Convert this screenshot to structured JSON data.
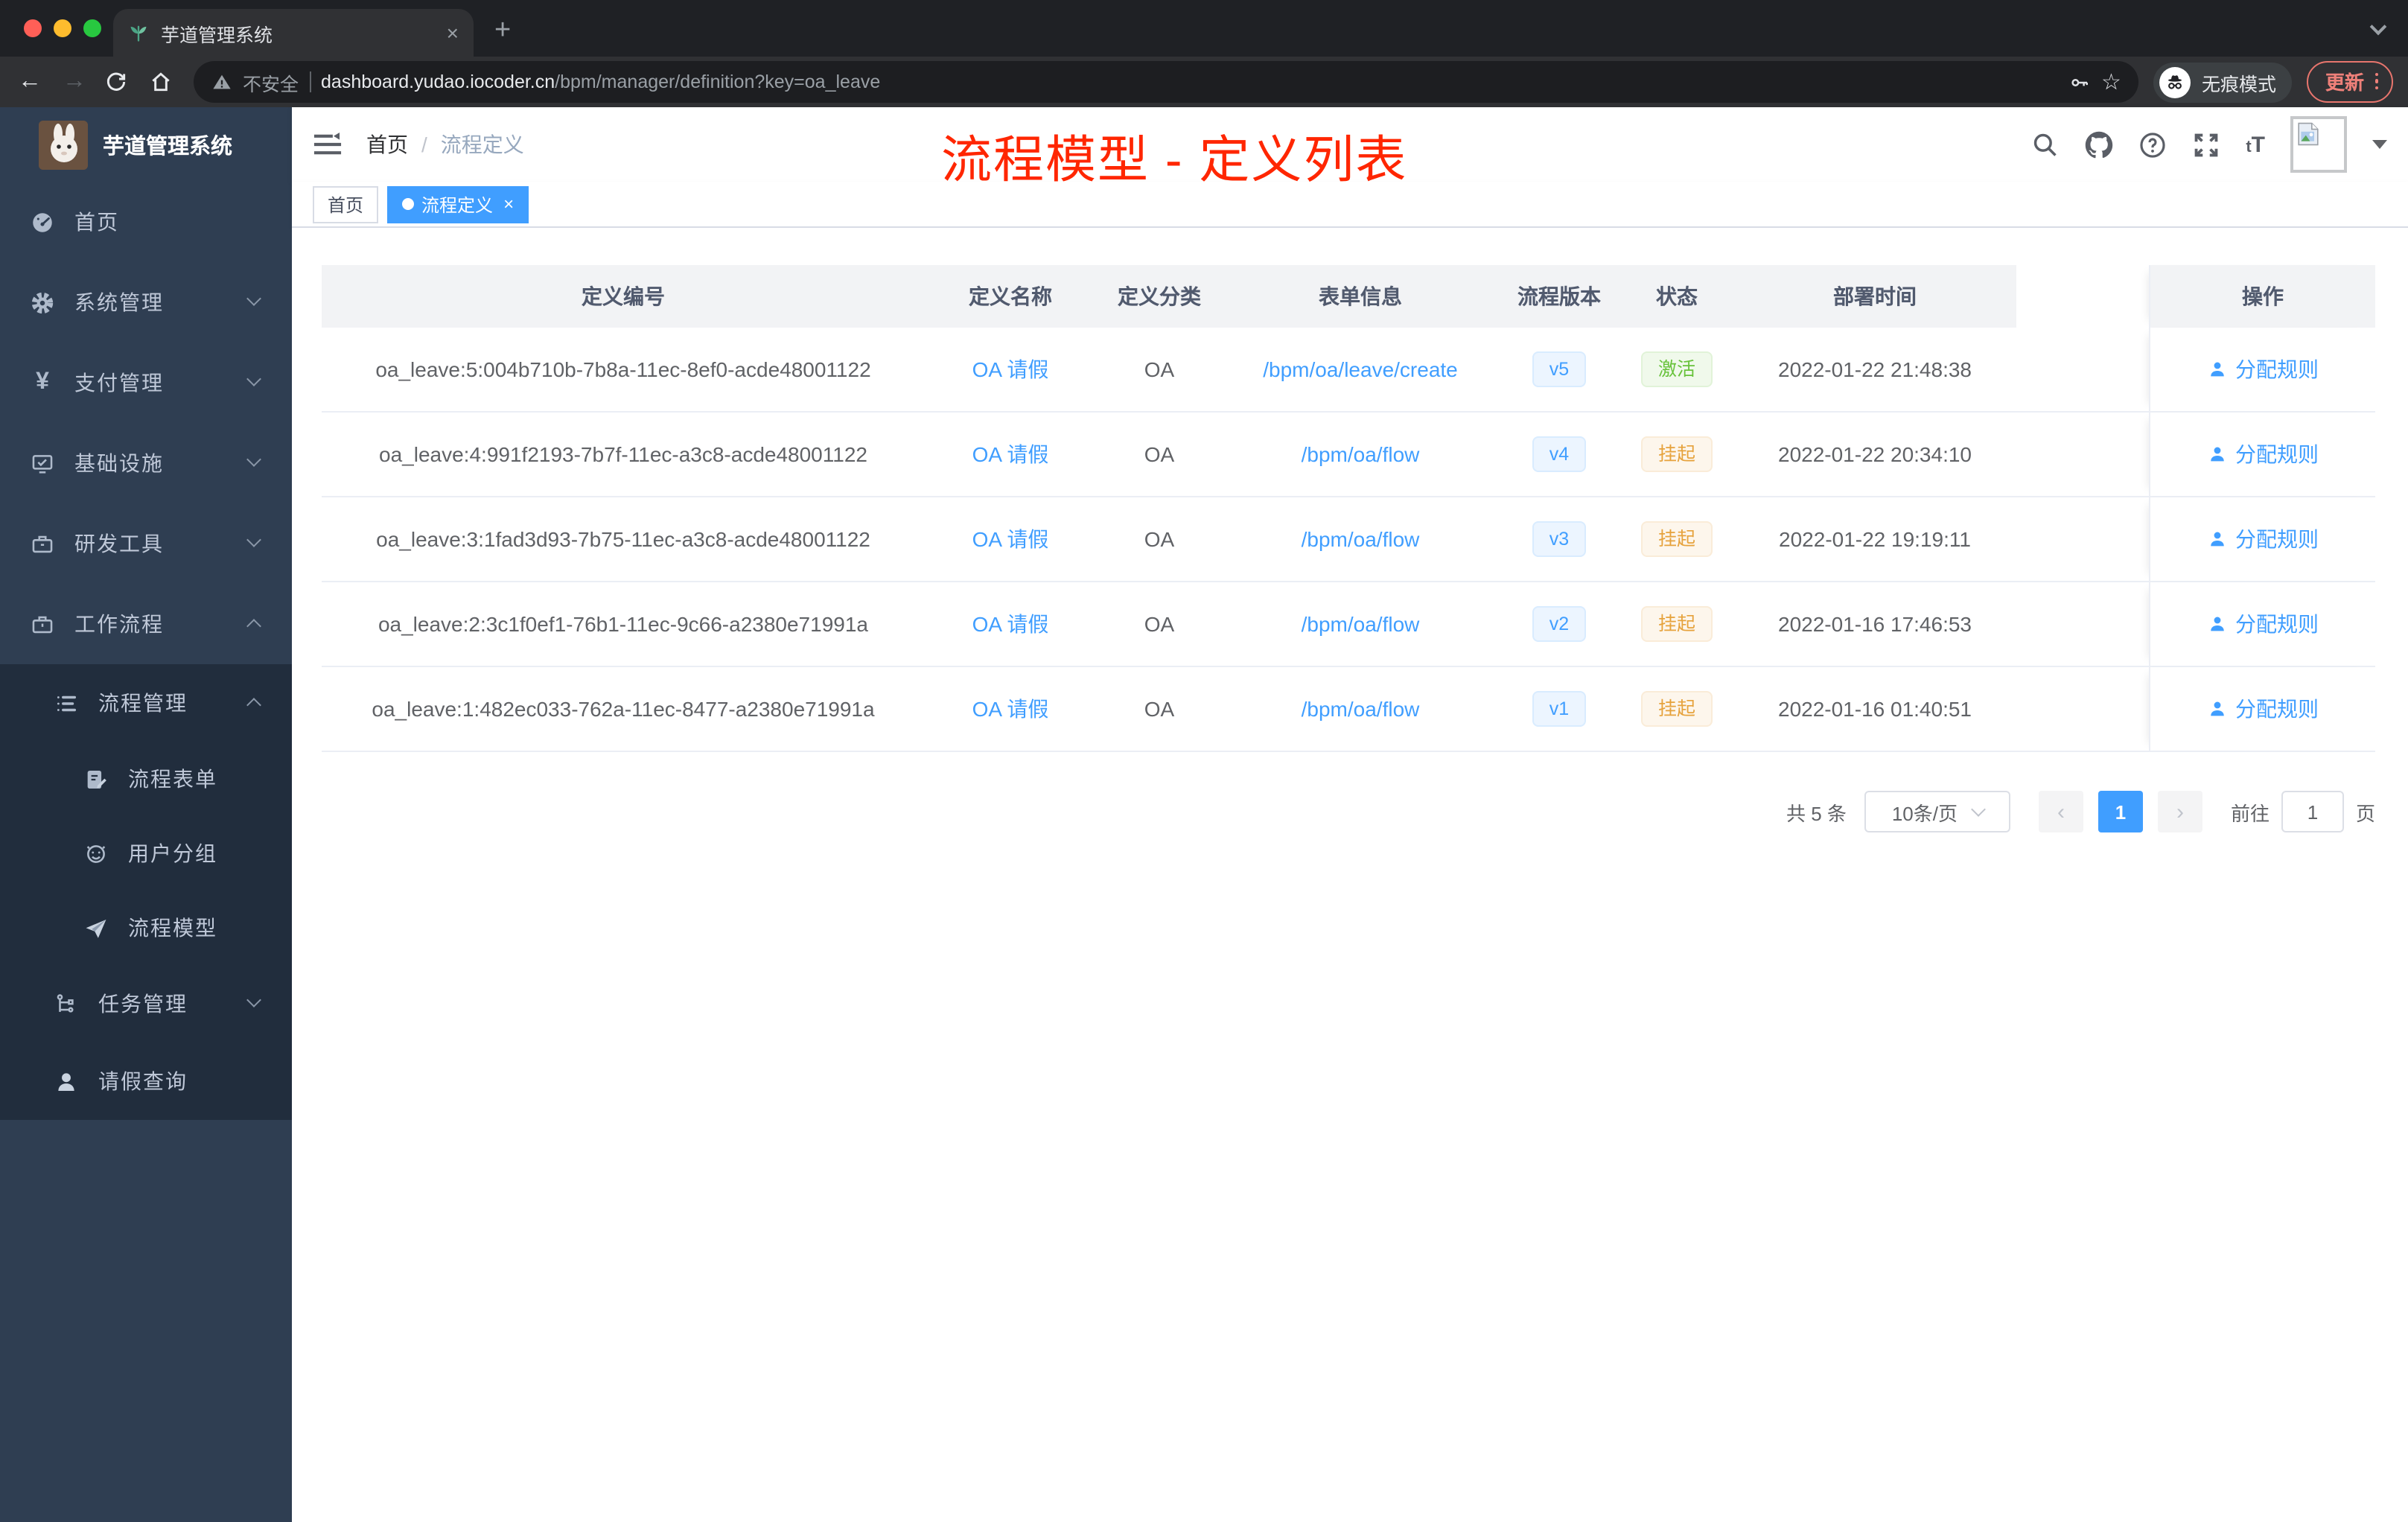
{
  "browser": {
    "tab_title": "芋道管理系统",
    "new_tab_label": "+",
    "tab_close": "×",
    "back": "←",
    "forward": "→",
    "security_label": "不安全",
    "url_domain": "dashboard.yudao.iocoder.cn",
    "url_path": "/bpm/manager/definition?key=oa_leave",
    "incognito_label": "无痕模式",
    "update_label": "更新"
  },
  "sidebar": {
    "logo_title": "芋道管理系统",
    "menu": [
      {
        "label": "首页"
      },
      {
        "label": "系统管理"
      },
      {
        "label": "支付管理"
      },
      {
        "label": "基础设施"
      },
      {
        "label": "研发工具"
      },
      {
        "label": "工作流程"
      }
    ],
    "submenu": {
      "process_mgmt": "流程管理",
      "children": [
        "流程表单",
        "用户分组",
        "流程模型"
      ],
      "task_mgmt": "任务管理",
      "leave_query": "请假查询"
    }
  },
  "navbar": {
    "breadcrumb": {
      "home": "首页",
      "current": "流程定义"
    }
  },
  "annotation": {
    "text": "流程模型 - 定义列表",
    "color": "#FF2600"
  },
  "tags": {
    "home": "首页",
    "active": "流程定义",
    "close": "×"
  },
  "table": {
    "columns": [
      "定义编号",
      "定义名称",
      "定义分类",
      "表单信息",
      "流程版本",
      "状态",
      "部署时间",
      "操作"
    ],
    "action_label": "分配规则",
    "rows": [
      {
        "id": "oa_leave:5:004b710b-7b8a-11ec-8ef0-acde48001122",
        "name": "OA 请假",
        "category": "OA",
        "form": "/bpm/oa/leave/create",
        "version": "v5",
        "status": "激活",
        "time": "2022-01-22 21:48:38",
        "action": "分配规则"
      },
      {
        "id": "oa_leave:4:991f2193-7b7f-11ec-a3c8-acde48001122",
        "name": "OA 请假",
        "category": "OA",
        "form": "/bpm/oa/flow",
        "version": "v4",
        "status": "挂起",
        "time": "2022-01-22 20:34:10",
        "action": "分配规则"
      },
      {
        "id": "oa_leave:3:1fad3d93-7b75-11ec-a3c8-acde48001122",
        "name": "OA 请假",
        "category": "OA",
        "form": "/bpm/oa/flow",
        "version": "v3",
        "status": "挂起",
        "time": "2022-01-22 19:19:11",
        "action": "分配规则"
      },
      {
        "id": "oa_leave:2:3c1f0ef1-76b1-11ec-9c66-a2380e71991a",
        "name": "OA 请假",
        "category": "OA",
        "form": "/bpm/oa/flow",
        "version": "v2",
        "status": "挂起",
        "time": "2022-01-16 17:46:53",
        "action": "分配规则"
      },
      {
        "id": "oa_leave:1:482ec033-762a-11ec-8477-a2380e71991a",
        "name": "OA 请假",
        "category": "OA",
        "form": "/bpm/oa/flow",
        "version": "v1",
        "status": "挂起",
        "time": "2022-01-16 01:40:51",
        "action": "分配规则"
      }
    ]
  },
  "pagination": {
    "total": "共 5 条",
    "page_size": "10条/页",
    "prev": "‹",
    "page": "1",
    "next": "›",
    "goto_label": "前往",
    "goto_value": "1",
    "unit_label": "页"
  },
  "colors": {
    "accent": "#409EFF",
    "status_active": "#67C23A",
    "status_suspended": "#E6A23C",
    "annotation_red": "#FF2600",
    "sidebar_bg": "#2F3E52",
    "submenu_bg": "#212D3D"
  }
}
